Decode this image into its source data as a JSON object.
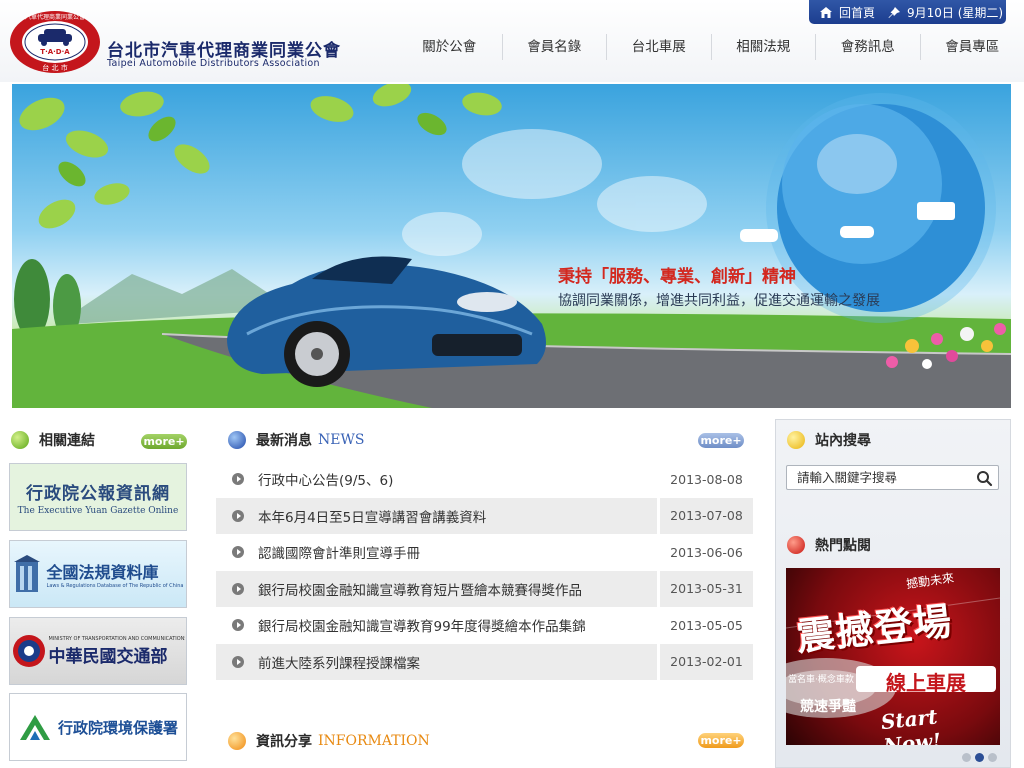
{
  "header": {
    "org_name_cn": "台北市汽車代理商業同業公會",
    "org_name_en": "Taipei Automobile Distributors Association",
    "seal_text_top": "汽車代理商業同業公會",
    "seal_text_mid": "T·A·D·A",
    "seal_text_bottom": "台 北 市",
    "home_label": "回首頁",
    "date_label": "9月10日 (星期二)",
    "nav": [
      "關於公會",
      "會員名錄",
      "台北車展",
      "相關法規",
      "會務訊息",
      "會員專區"
    ]
  },
  "banner": {
    "slogan": "秉持「服務、專業、創新」精神",
    "subslogan": "協調同業關係，增進共同利益，促進交通運輸之發展"
  },
  "links": {
    "title": "相關連結",
    "more_label": "more+",
    "items": [
      {
        "title": "行政院公報資訊網",
        "subtitle": "The Executive Yuan Gazette Online"
      },
      {
        "title": "全國法規資料庫",
        "subtitle": "Laws & Regulations Database of The Republic of China"
      },
      {
        "title": "中華民國交通部",
        "subtitle": "MINISTRY OF TRANSPORTATION AND COMMUNICATIONS"
      },
      {
        "title": "行政院環境保護署",
        "subtitle": ""
      }
    ]
  },
  "news": {
    "title_cn": "最新消息",
    "title_en": "NEWS",
    "more_label": "more+",
    "items": [
      {
        "title": "行政中心公告(9/5、6)",
        "date": "2013-08-08"
      },
      {
        "title": "本年6月4日至5日宣導講習會講義資料",
        "date": "2013-07-08"
      },
      {
        "title": "認識國際會計準則宣導手冊",
        "date": "2013-06-06"
      },
      {
        "title": "銀行局校園金融知識宣導教育短片暨繪本競賽得獎作品",
        "date": "2013-05-31"
      },
      {
        "title": "銀行局校園金融知識宣導教育99年度得獎繪本作品集錦",
        "date": "2013-05-05"
      },
      {
        "title": "前進大陸系列課程授課檔案",
        "date": "2013-02-01"
      }
    ]
  },
  "info": {
    "title_cn": "資訊分享",
    "title_en": "INFORMATION",
    "more_label": "more+"
  },
  "sidebar": {
    "search_title": "站內搜尋",
    "search_placeholder": "請輸入關鍵字搜尋",
    "hot_title": "熱門點閱",
    "ad_line1": "撼動未來",
    "ad_headline": "震撼登場",
    "ad_tag": "線上車展",
    "ad_line2": "當名車‧概念車款",
    "ad_line3": "競速爭豔",
    "ad_script": "Start Now!",
    "carousel_active": 2
  }
}
